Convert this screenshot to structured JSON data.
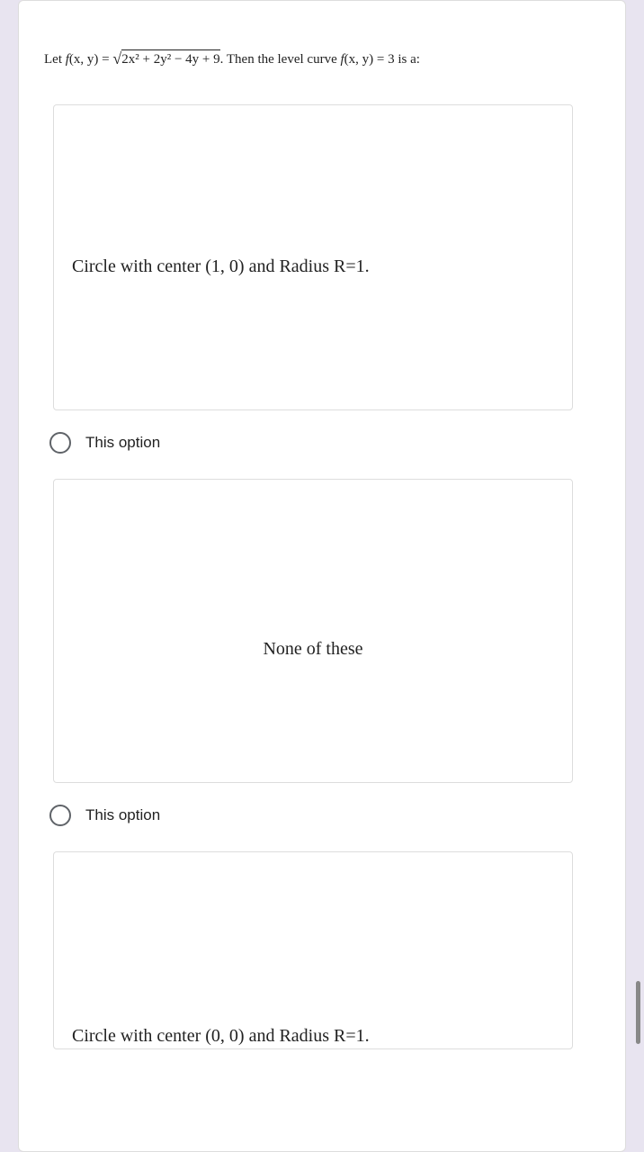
{
  "question": {
    "prefix": "Let ",
    "fxy1_f": "f",
    "fxy1_args": "(x, y) = ",
    "radicand": "2x² + 2y² − 4y + 9",
    "middle": ". Then the level curve ",
    "fxy2_f": "f",
    "fxy2_args": "(x, y) = 3",
    "suffix": " is a:"
  },
  "options": {
    "opt1": {
      "text": "Circle with center (1, 0) and Radius R=1.",
      "radio_label": "This option"
    },
    "opt2": {
      "text": "None of these",
      "radio_label": "This option"
    },
    "opt3": {
      "text": "Circle with center (0, 0) and Radius R=1."
    }
  }
}
